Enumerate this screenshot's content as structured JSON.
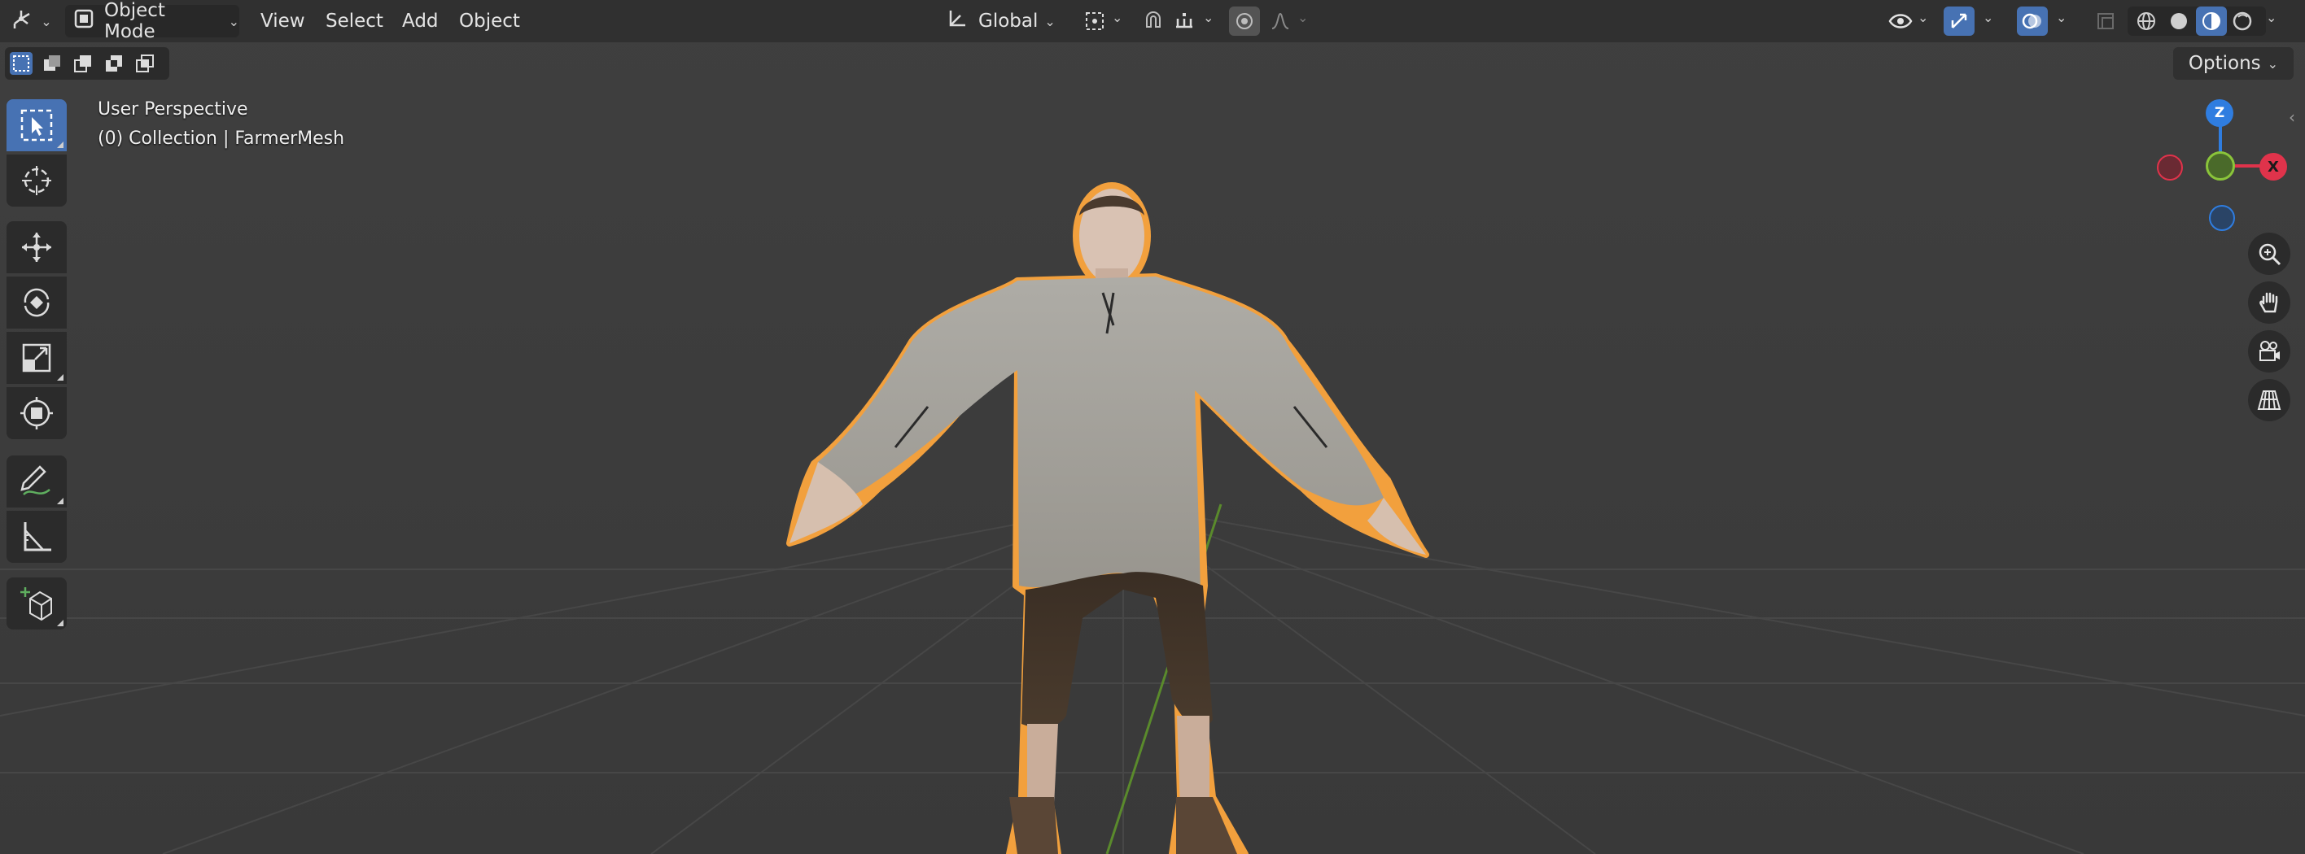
{
  "header": {
    "editor_type_icon": "3d-viewport-icon",
    "mode_label": "Object Mode",
    "menus": [
      "View",
      "Select",
      "Add",
      "Object"
    ],
    "transform_orientation": "Global",
    "pivot_icon": "pivot-point-icon",
    "snap_icon": "snap-magnet-icon",
    "snap_target_icon": "snap-increment-icon",
    "proportional_icon": "proportional-edit-icon",
    "falloff_icon": "falloff-curve-icon",
    "visibility_icon": "eye-icon",
    "gizmo_icon": "gizmo-icon",
    "overlay_icon": "overlay-icon",
    "xray_icon": "xray-icon",
    "shading_modes": [
      "wireframe",
      "solid",
      "material-preview",
      "rendered"
    ],
    "active_shading": "material-preview"
  },
  "toolheader": {
    "selection_modes": [
      "set",
      "extend",
      "subtract",
      "difference",
      "intersect"
    ],
    "active_selection_mode": "set",
    "options_label": "Options"
  },
  "toolbar": {
    "tools": [
      "select-box",
      "cursor",
      "move",
      "rotate",
      "scale",
      "transform",
      "annotate",
      "measure",
      "add-cube"
    ],
    "active_tool": "select-box"
  },
  "viewport": {
    "perspective_label": "User Perspective",
    "collection_label": "(0) Collection | FarmerMesh",
    "object_name": "FarmerMesh",
    "selection_outline_color": "#f2a03d",
    "grid_color": "#4a4a4a",
    "background_color": "#3d3d3d"
  },
  "nav_gizmo": {
    "axes": {
      "z": "Z",
      "x": "X"
    },
    "colors": {
      "x": "#e0334b",
      "y": "#8ac43a",
      "z": "#2f7de0"
    },
    "nav_buttons": [
      "zoom-icon",
      "pan-hand-icon",
      "camera-icon",
      "ortho-grid-icon"
    ]
  },
  "colors": {
    "accent": "#4772b3",
    "header_bg": "#303030",
    "panel_bg": "#2b2b2b"
  }
}
